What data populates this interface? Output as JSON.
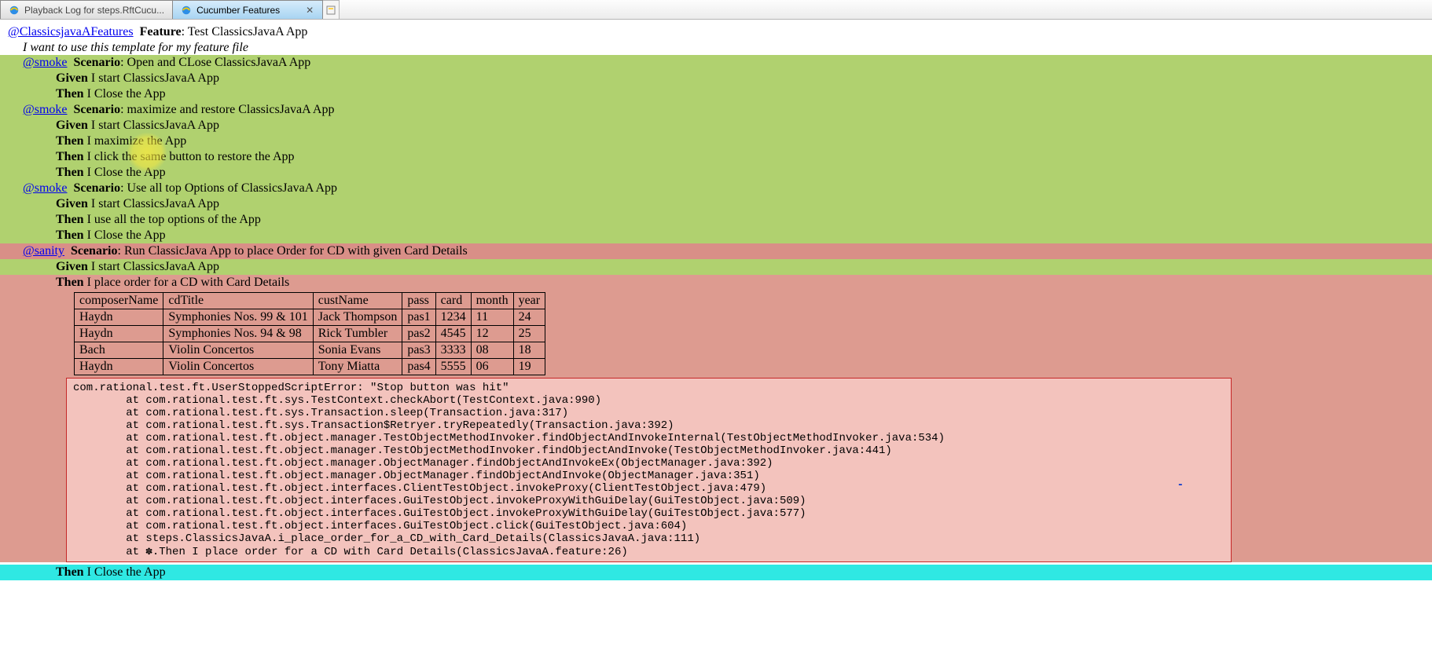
{
  "tabs": {
    "inactive_label": "Playback Log for steps.RftCucu...",
    "active_label": "Cucumber Features"
  },
  "feature": {
    "tag": "@ClassicsjavaAFeatures",
    "keyword": "Feature",
    "title": "Test ClassicsJavaA App",
    "description": "I want to use this template for my feature file"
  },
  "scenarios": [
    {
      "tag": "@smoke",
      "keyword": "Scenario",
      "title": "Open and CLose ClassicsJavaA App",
      "steps": [
        {
          "kw": "Given",
          "text": "I start ClassicsJavaA App"
        },
        {
          "kw": "Then",
          "text": "I Close the App"
        }
      ]
    },
    {
      "tag": "@smoke",
      "keyword": "Scenario",
      "title": "maximize and restore ClassicsJavaA App",
      "steps": [
        {
          "kw": "Given",
          "text": "I start ClassicsJavaA App"
        },
        {
          "kw": "Then",
          "text": "I maximize the App"
        },
        {
          "kw": "Then",
          "text": "I click the same button to restore the App"
        },
        {
          "kw": "Then",
          "text": "I Close the App"
        }
      ]
    },
    {
      "tag": "@smoke",
      "keyword": "Scenario",
      "title": "Use all top Options of ClassicsJavaA App",
      "steps": [
        {
          "kw": "Given",
          "text": "I start ClassicsJavaA App"
        },
        {
          "kw": "Then",
          "text": "I use all the top options of the App"
        },
        {
          "kw": "Then",
          "text": "I Close the App"
        }
      ]
    }
  ],
  "failing_scenario": {
    "tag": "@sanity",
    "keyword": "Scenario",
    "title": "Run ClassicJava App to place Order for CD with given Card Details",
    "step_given": {
      "kw": "Given",
      "text": "I start ClassicsJavaA App"
    },
    "step_then_fail": {
      "kw": "Then",
      "text": "I place order for a CD with Card Details"
    },
    "step_then_close": {
      "kw": "Then",
      "text": "I Close the App"
    }
  },
  "table": {
    "headers": [
      "composerName",
      "cdTitle",
      "custName",
      "pass",
      "card",
      "month",
      "year"
    ],
    "rows": [
      [
        "Haydn",
        "Symphonies Nos. 99 & 101",
        "Jack Thompson",
        "pas1",
        "1234",
        "11",
        "24"
      ],
      [
        "Haydn",
        "Symphonies Nos. 94 & 98",
        "Rick Tumbler",
        "pas2",
        "4545",
        "12",
        "25"
      ],
      [
        "Bach",
        "Violin Concertos",
        "Sonia Evans",
        "pas3",
        "3333",
        "08",
        "18"
      ],
      [
        "Haydn",
        "Violin Concertos",
        "Tony Miatta",
        "pas4",
        "5555",
        "06",
        "19"
      ]
    ]
  },
  "error": {
    "message": "com.rational.test.ft.UserStoppedScriptError: \"Stop button was hit\"",
    "trace": [
      "at com.rational.test.ft.sys.TestContext.checkAbort(TestContext.java:990)",
      "at com.rational.test.ft.sys.Transaction.sleep(Transaction.java:317)",
      "at com.rational.test.ft.sys.Transaction$Retryer.tryRepeatedly(Transaction.java:392)",
      "at com.rational.test.ft.object.manager.TestObjectMethodInvoker.findObjectAndInvokeInternal(TestObjectMethodInvoker.java:534)",
      "at com.rational.test.ft.object.manager.TestObjectMethodInvoker.findObjectAndInvoke(TestObjectMethodInvoker.java:441)",
      "at com.rational.test.ft.object.manager.ObjectManager.findObjectAndInvokeEx(ObjectManager.java:392)",
      "at com.rational.test.ft.object.manager.ObjectManager.findObjectAndInvoke(ObjectManager.java:351)",
      "at com.rational.test.ft.object.interfaces.ClientTestObject.invokeProxy(ClientTestObject.java:479)",
      "at com.rational.test.ft.object.interfaces.GuiTestObject.invokeProxyWithGuiDelay(GuiTestObject.java:509)",
      "at com.rational.test.ft.object.interfaces.GuiTestObject.invokeProxyWithGuiDelay(GuiTestObject.java:577)",
      "at com.rational.test.ft.object.interfaces.GuiTestObject.click(GuiTestObject.java:604)",
      "at steps.ClassicsJavaA.i_place_order_for_a_CD_with_Card_Details(ClassicsJavaA.java:111)",
      "at ✽.Then I place order for a CD with Card Details(ClassicsJavaA.feature:26)"
    ]
  }
}
